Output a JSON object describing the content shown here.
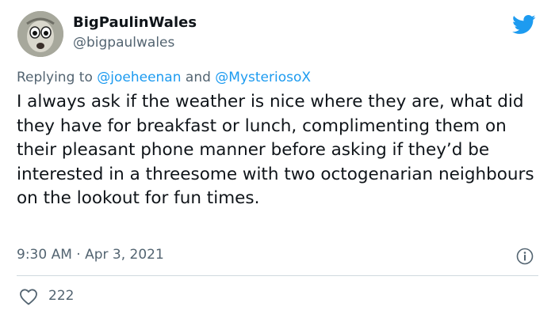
{
  "user": {
    "display_name": "BigPaulinWales",
    "handle": "@bigpaulwales",
    "avatar_icon": "avatar-portrait"
  },
  "reply": {
    "prefix": "Replying to",
    "mention_1": "@joeheenan",
    "conjunction": "and",
    "mention_2": "@MysteriosoX"
  },
  "tweet": {
    "text": "I always ask if the weather is nice where they are, what did they have for breakfast or lunch, complimenting them on their pleasant phone manner before asking if they’d be interested in a threesome with two octogenarian neighbours on the lookout for fun times.",
    "time": "9:30 AM",
    "separator": "·",
    "date": "Apr 3, 2021"
  },
  "engagement": {
    "likes": "222"
  },
  "icons": {
    "brand": "twitter-bird-icon",
    "info": "info-icon",
    "like": "heart-icon"
  },
  "colors": {
    "brand_blue": "#1d9bf0",
    "secondary_text": "#536471",
    "primary_text": "#0f1419",
    "divider": "#cfd9de"
  }
}
